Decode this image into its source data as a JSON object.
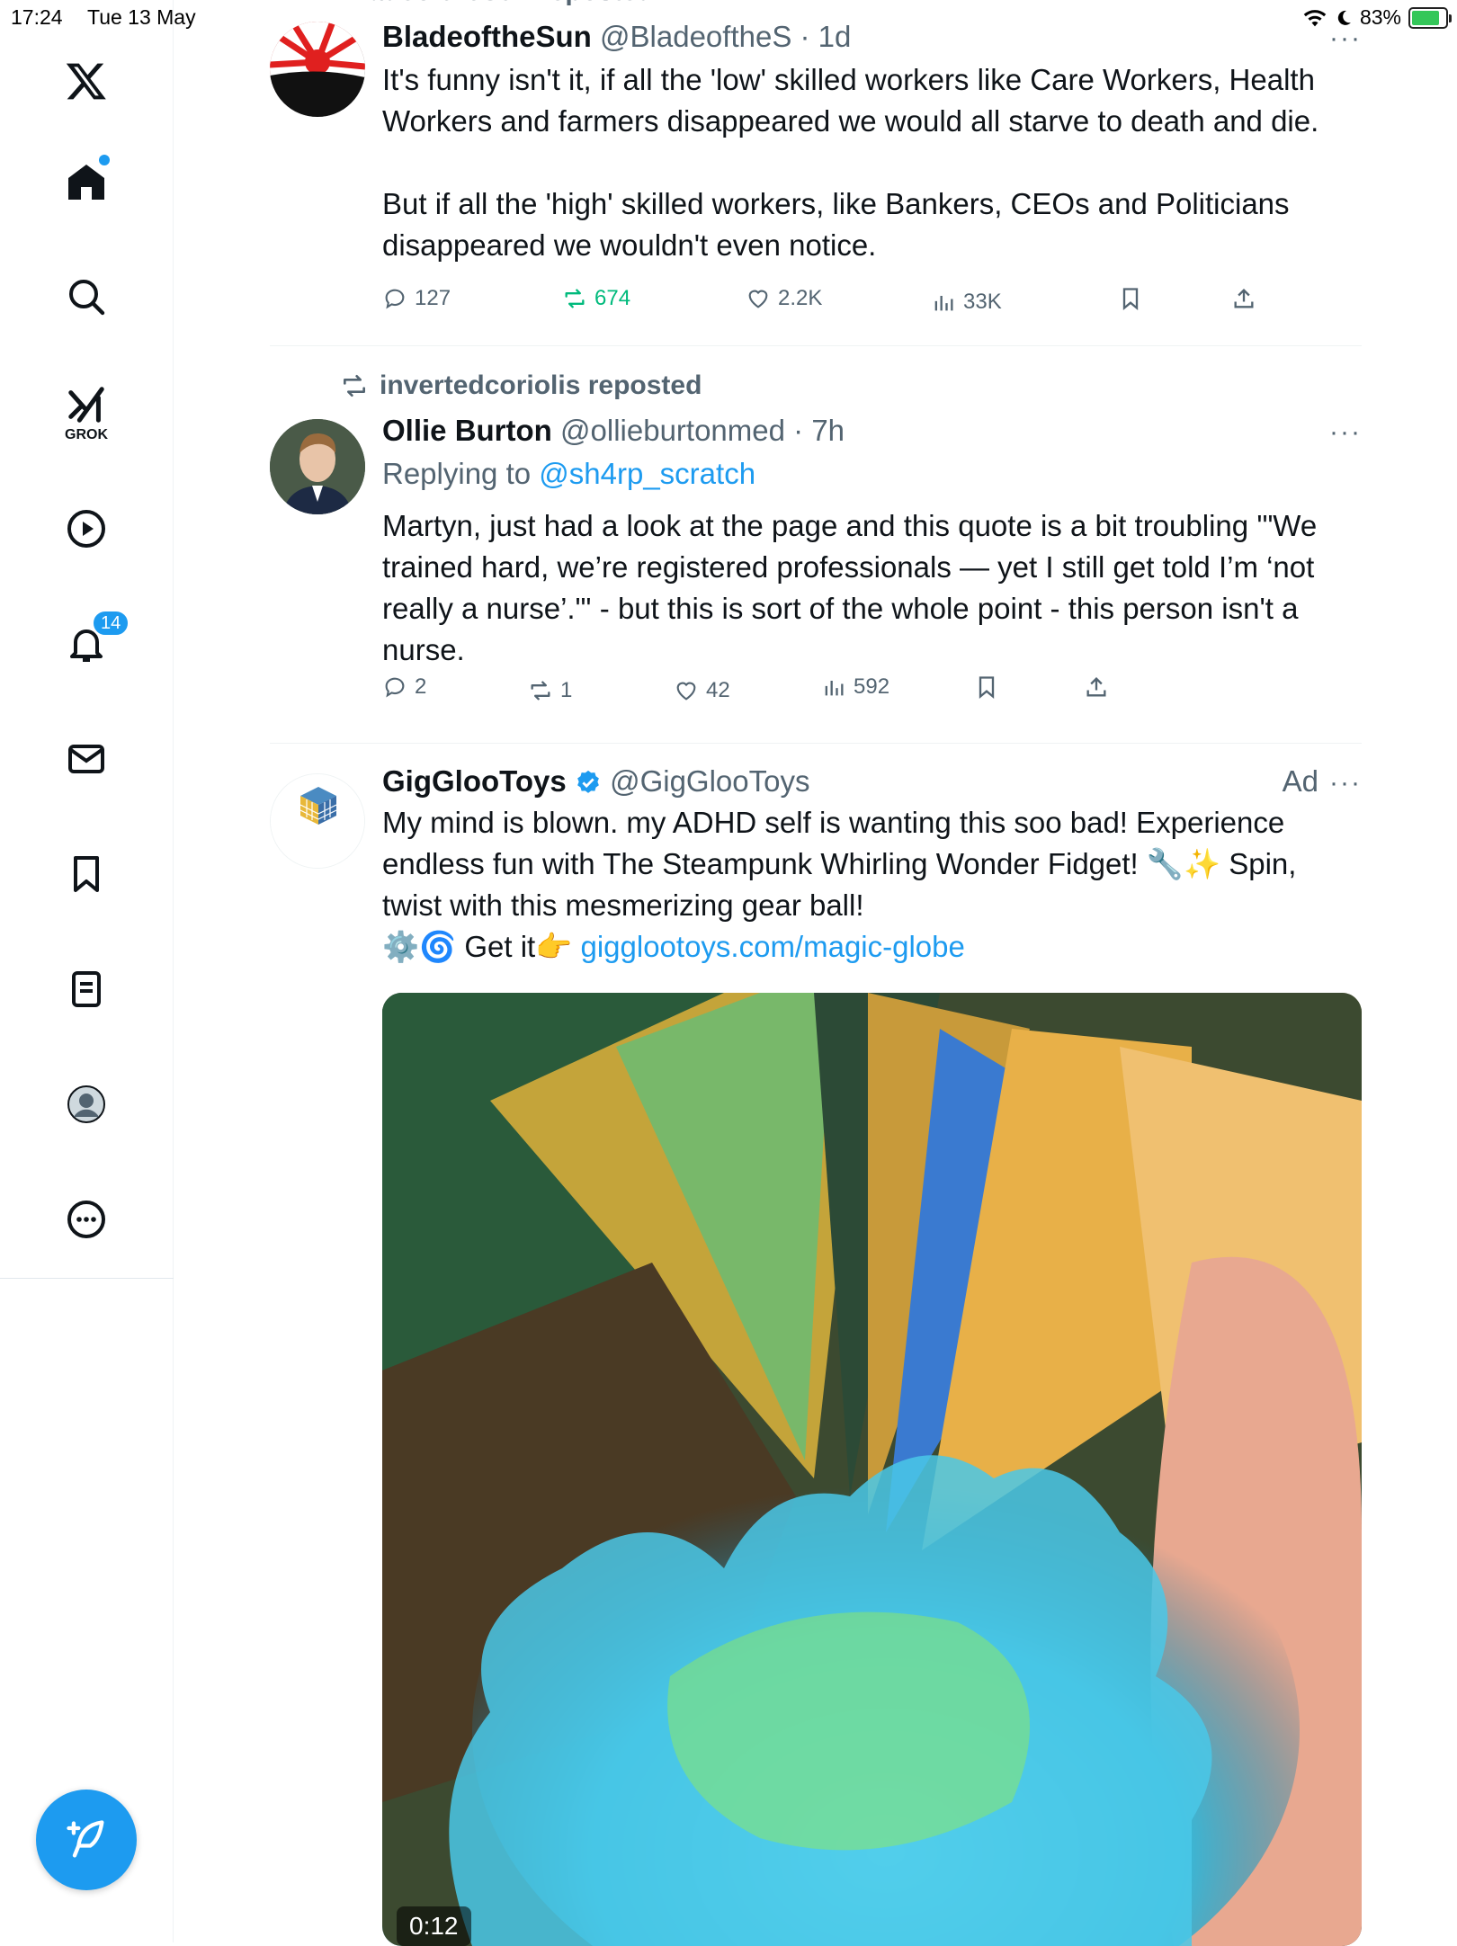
{
  "status_bar": {
    "time": "17:24",
    "date": "Tue 13 May",
    "battery": "83%"
  },
  "sidebar": {
    "items": [
      {
        "name": "x-logo"
      },
      {
        "name": "home",
        "has_dot": true
      },
      {
        "name": "search"
      },
      {
        "name": "grok",
        "label": "GROK"
      },
      {
        "name": "video"
      },
      {
        "name": "notifications",
        "badge": "14"
      },
      {
        "name": "messages"
      },
      {
        "name": "bookmarks"
      },
      {
        "name": "lists"
      },
      {
        "name": "profile"
      },
      {
        "name": "more"
      }
    ]
  },
  "tweets": [
    {
      "repost_header": "BladeoftheSun reposted",
      "name": "BladeoftheSun",
      "handle": "@BladeoftheS",
      "time": "1d",
      "text": "It's funny isn't it, if all the 'low' skilled workers like Care Workers, Health Workers and farmers disappeared we would all starve to death and die.\n\nBut if all the 'high' skilled workers, like Bankers, CEOs and Politicians disappeared we wouldn't even notice.",
      "replies": "127",
      "reposts": "674",
      "likes": "2.2K",
      "views": "33K"
    },
    {
      "repost_header": "invertedcoriolis reposted",
      "name": "Ollie Burton",
      "handle": "@ollieburtonmed",
      "time": "7h",
      "replying_label": "Replying to",
      "replying_to": "@sh4rp_scratch",
      "text": "Martyn, just had a look at the page and this quote is a bit troubling '\"We trained hard, we’re registered professionals — yet I still get told I’m ‘not really a nurse’.\"' - but this is sort of the whole point - this person isn't a nurse.",
      "replies": "2",
      "reposts": "1",
      "likes": "42",
      "views": "592"
    },
    {
      "name": "GigGlooToys",
      "handle": "@GigGlooToys",
      "ad_label": "Ad",
      "text": "My mind is blown. my ADHD self is wanting this soo bad! Experience endless fun with The Steampunk Whirling Wonder Fidget! 🔧✨ Spin, twist with this mesmerizing gear ball!\n⚙️🌀 Get it👉 ",
      "link": "gigglootoys.com/magic-globe",
      "video_time": "0:12"
    }
  ],
  "colors": {
    "accent": "#1d9bf0",
    "repost_green": "#00ba7c",
    "secondary_text": "#536471"
  }
}
